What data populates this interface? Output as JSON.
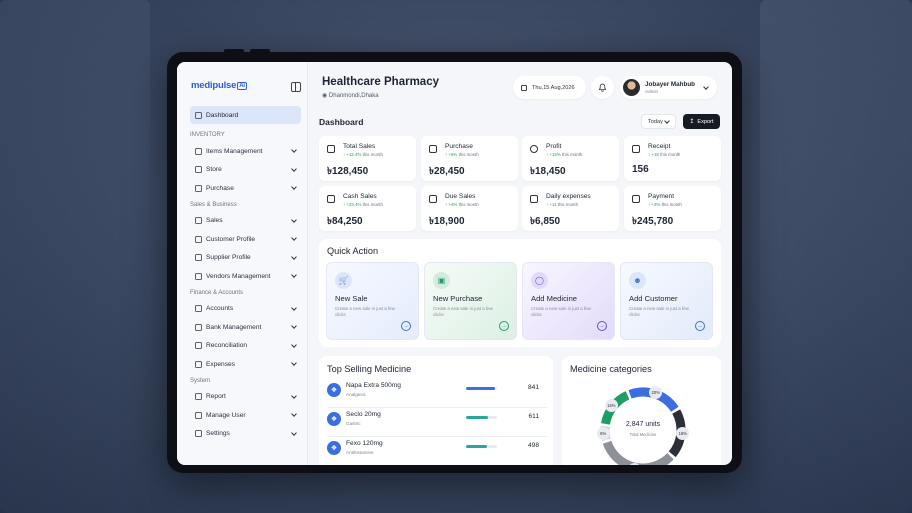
{
  "brand": {
    "name": "medipulse",
    "badge": "Ai"
  },
  "sidebar": {
    "dashboard": "Dashboard",
    "sections": [
      {
        "title": "INVENTORY",
        "items": [
          "Items Management",
          "Store",
          "Purchase"
        ]
      },
      {
        "title": "Sales & Business",
        "items": [
          "Sales",
          "Customer Profile",
          "Supplier Profile",
          "Vendors Management"
        ]
      },
      {
        "title": "Finance & Accounts",
        "items": [
          "Accounts",
          "Bank Management",
          "Reconciliation",
          "Expenses"
        ]
      },
      {
        "title": "System",
        "items": [
          "Report",
          "Manage User",
          "Settings"
        ]
      }
    ]
  },
  "header": {
    "title": "Healthcare Pharmacy",
    "location": "Dhanmondi,Dhaka",
    "date": "Thu,15 Aug,2026",
    "user_name": "Jobayer Mahbub",
    "user_role": "Admin"
  },
  "dashboard": {
    "title": "Dashboard",
    "range": "Today",
    "export_label": "Export"
  },
  "stats": [
    {
      "label": "Total Sales",
      "change": "+12.4%",
      "suffix": "this month",
      "value": "৳128,450",
      "icon": "cart-icon"
    },
    {
      "label": "Purchase",
      "change": "+8%",
      "suffix": "this month",
      "value": "৳28,450",
      "icon": "bag-icon"
    },
    {
      "label": "Profit",
      "change": "+15%",
      "suffix": "this month",
      "value": "৳18,450",
      "icon": "coin-icon"
    },
    {
      "label": "Receipt",
      "change": "+18",
      "suffix": "this month",
      "value": "156",
      "icon": "receipt-icon"
    },
    {
      "label": "Cash Sales",
      "change": "+23.4%",
      "suffix": "this month",
      "value": "৳84,250",
      "icon": "cash-icon"
    },
    {
      "label": "Due Sales",
      "change": "+4%",
      "suffix": "this month",
      "value": "৳18,900",
      "icon": "due-icon"
    },
    {
      "label": "Daily expenses",
      "change": "+11",
      "suffix": "this month",
      "value": "৳6,850",
      "icon": "wallet-icon"
    },
    {
      "label": "Payment",
      "change": "+2%",
      "suffix": "this month",
      "value": "৳245,780",
      "icon": "card-icon"
    }
  ],
  "quick_action": {
    "title": "Quick Action",
    "cards": [
      {
        "title": "New Sale",
        "desc": "Create a new sale in just a few clicks",
        "accent": "#3b6fe0",
        "bg": "#eef3fd"
      },
      {
        "title": "New Purchase",
        "desc": "Create a new sale in just a few clicks",
        "accent": "#1f9d66",
        "bg": "#eaf6ef"
      },
      {
        "title": "Add Medicine",
        "desc": "Create a new sale in just a few clicks",
        "accent": "#6d4bd6",
        "bg": "#efeafb"
      },
      {
        "title": "Add Customer",
        "desc": "Create a new sale in just a few clicks",
        "accent": "#3b6fe0",
        "bg": "#eef4fc"
      }
    ]
  },
  "top_selling": {
    "title": "Top Selling Medicine",
    "rows": [
      {
        "name": "Napa Extra 500mg",
        "category": "Analgesic",
        "qty": "841",
        "level": 0.92,
        "color": "#3b6fe0"
      },
      {
        "name": "Seclo 20mg",
        "category": "Gastric",
        "qty": "611",
        "level": 0.72,
        "color": "#2aa59a"
      },
      {
        "name": "Fexo 120mg",
        "category": "Antihistamine",
        "qty": "498",
        "level": 0.68,
        "color": "#2aa59a"
      }
    ]
  },
  "categories": {
    "title": "Medicine categories",
    "total": "2,847 units",
    "total_label": "Total Medicine",
    "segments": [
      {
        "label": "20%",
        "value": 20,
        "color": "#3b6fe0"
      },
      {
        "label": "18%",
        "value": 18,
        "color": "#2b2f38"
      },
      {
        "label": "30%",
        "value": 30,
        "color": "#8e9199"
      },
      {
        "label": "6%",
        "value": 6,
        "color": "#cfd3da"
      },
      {
        "label": "15%",
        "value": 15,
        "color": "#1f9d66"
      }
    ]
  }
}
